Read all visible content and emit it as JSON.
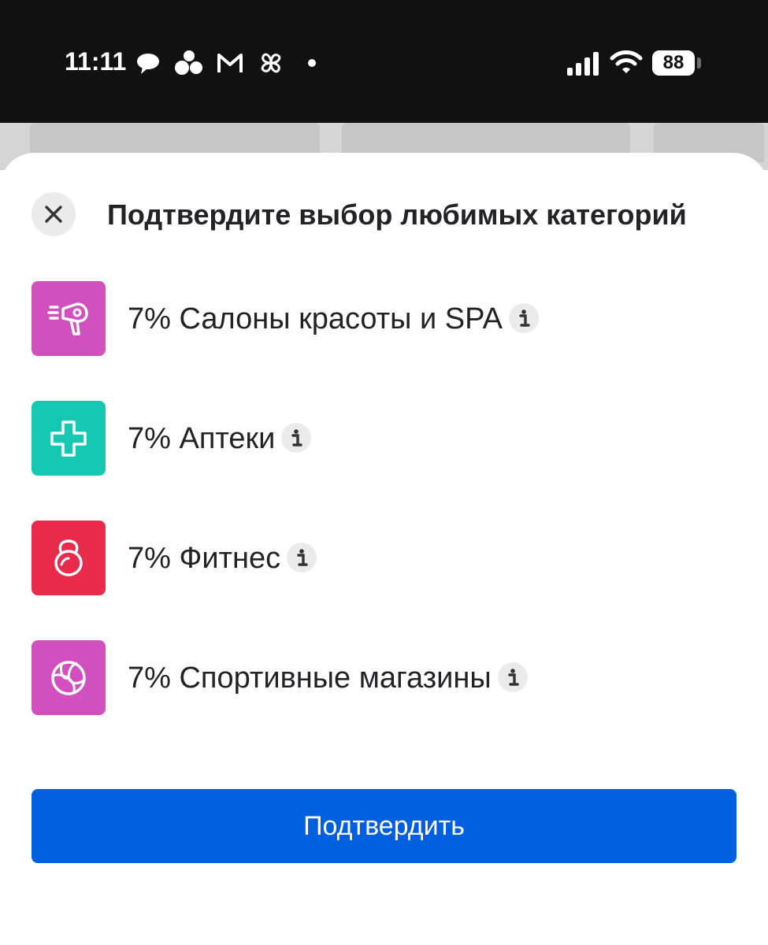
{
  "status_bar": {
    "time": "11:11",
    "battery": "88",
    "icons": [
      "chat-bubble-icon",
      "dots-cluster-icon",
      "mail-m-icon",
      "pinwheel-icon",
      "notification-dot-icon",
      "signal-icon",
      "wifi-icon",
      "battery-icon"
    ]
  },
  "sheet": {
    "title": "Подтвердите выбор любимых категорий",
    "close_icon": "close-icon",
    "categories": [
      {
        "label": "7% Салоны красоты и SPA",
        "icon": "hair-dryer-icon",
        "color": "#d14fbe"
      },
      {
        "label": "7% Аптеки",
        "icon": "medical-cross-icon",
        "color": "#16c8b1"
      },
      {
        "label": "7% Фитнес",
        "icon": "kettlebell-icon",
        "color": "#e82b4b"
      },
      {
        "label": "7% Спортивные магазины",
        "icon": "volleyball-icon",
        "color": "#d14fbe"
      }
    ],
    "confirm_label": "Подтвердить"
  },
  "colors": {
    "accent": "#005fde",
    "status_bar_bg": "#111111",
    "text": "#222326",
    "info_bg": "#ebebeb"
  }
}
